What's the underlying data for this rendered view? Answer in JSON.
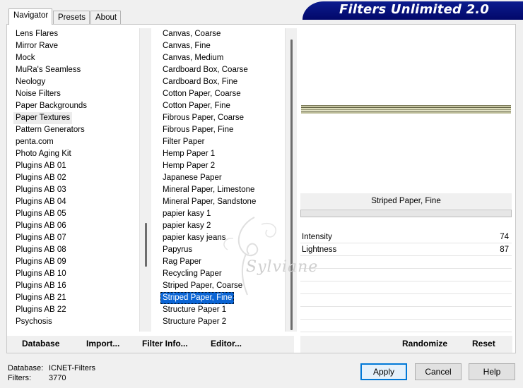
{
  "tabs": [
    {
      "label": "Navigator",
      "active": true
    },
    {
      "label": "Presets",
      "active": false
    },
    {
      "label": "About",
      "active": false
    }
  ],
  "title": "Filters Unlimited 2.0",
  "categories": {
    "items": [
      "Lens Flares",
      "Mirror Rave",
      "Mock",
      "MuRa's Seamless",
      "Neology",
      "Noise Filters",
      "Paper Backgrounds",
      "Paper Textures",
      "Pattern Generators",
      "penta.com",
      "Photo Aging Kit",
      "Plugins AB 01",
      "Plugins AB 02",
      "Plugins AB 03",
      "Plugins AB 04",
      "Plugins AB 05",
      "Plugins AB 06",
      "Plugins AB 07",
      "Plugins AB 08",
      "Plugins AB 09",
      "Plugins AB 10",
      "Plugins AB 16",
      "Plugins AB 21",
      "Plugins AB 22",
      "Psychosis"
    ],
    "selected": "Paper Textures"
  },
  "filters": {
    "items": [
      "Canvas, Coarse",
      "Canvas, Fine",
      "Canvas, Medium",
      "Cardboard Box, Coarse",
      "Cardboard Box, Fine",
      "Cotton Paper, Coarse",
      "Cotton Paper, Fine",
      "Fibrous Paper, Coarse",
      "Fibrous Paper, Fine",
      "Filter Paper",
      "Hemp Paper 1",
      "Hemp Paper 2",
      "Japanese Paper",
      "Mineral Paper, Limestone",
      "Mineral Paper, Sandstone",
      "papier kasy 1",
      "papier kasy 2",
      "papier kasy jeans",
      "Papyrus",
      "Rag Paper",
      "Recycling Paper",
      "Striped Paper, Coarse",
      "Striped Paper, Fine",
      "Structure Paper 1",
      "Structure Paper 2"
    ],
    "selected": "Striped Paper, Fine"
  },
  "preview": {
    "filter_name": "Striped Paper, Fine"
  },
  "sliders": [
    {
      "label": "Intensity",
      "value": "74",
      "fraction": 0.29
    },
    {
      "label": "Lightness",
      "value": "87",
      "fraction": 0.34
    }
  ],
  "toolbar": {
    "database": "Database",
    "import": "Import...",
    "filter_info": "Filter Info...",
    "editor": "Editor...",
    "randomize": "Randomize",
    "reset": "Reset"
  },
  "status": {
    "database_label": "Database:",
    "database_value": "ICNET-Filters",
    "filters_label": "Filters:",
    "filters_value": "3770"
  },
  "buttons": {
    "apply": "Apply",
    "cancel": "Cancel",
    "help": "Help"
  },
  "watermark": "Sylviane",
  "colors": {
    "title_bg": "#02086a",
    "selection_blue": "#0a64d4",
    "selection_gray": "#ececec"
  }
}
